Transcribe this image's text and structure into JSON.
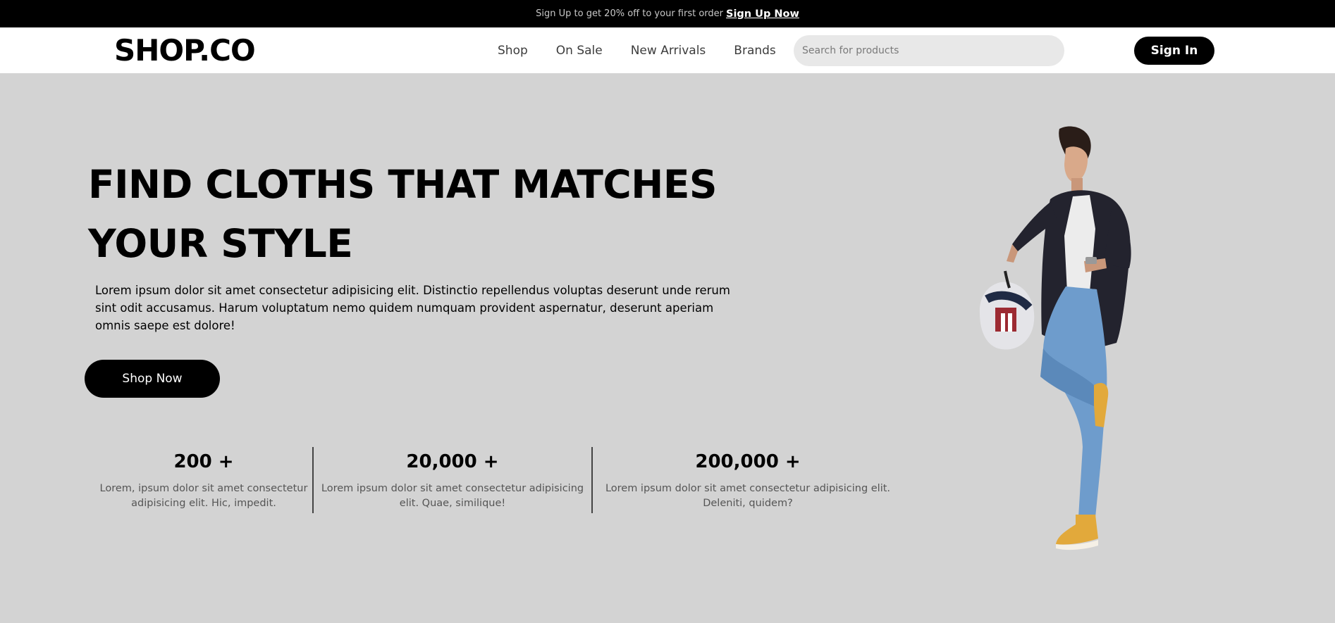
{
  "announcement": {
    "text": "Sign Up to get 20% off to your first order",
    "link": "Sign Up Now"
  },
  "header": {
    "logo": "SHOP.CO",
    "nav": [
      "Shop",
      "On Sale",
      "New Arrivals",
      "Brands"
    ],
    "search_placeholder": "Search for products",
    "sign_in": "Sign In"
  },
  "hero": {
    "title_line1": "FIND CLOTHS THAT MATCHES",
    "title_line2": "YOUR STYLE",
    "description": "Lorem ipsum dolor sit amet consectetur adipisicing elit. Distinctio repellendus voluptas deserunt unde rerum sint odit accusamus. Harum voluptatum nemo quidem numquam provident aspernatur, deserunt aperiam omnis saepe est dolore!",
    "cta": "Shop Now"
  },
  "stats": [
    {
      "value": "200 +",
      "text": "Lorem, ipsum dolor sit amet consectetur adipisicing elit. Hic, impedit."
    },
    {
      "value": "20,000 +",
      "text": "Lorem ipsum dolor sit amet consectetur adipisicing elit. Quae, similique!"
    },
    {
      "value": "200,000 +",
      "text": "Lorem ipsum dolor sit amet consectetur adipisicing elit. Deleniti, quidem?"
    }
  ],
  "colors": {
    "background": "#d3d3d3",
    "primary": "#000000",
    "search_bg": "#e8e8e8",
    "shoe_yellow": "#e2a93b",
    "denim": "#6e9ccc",
    "jacket": "#23232e"
  }
}
